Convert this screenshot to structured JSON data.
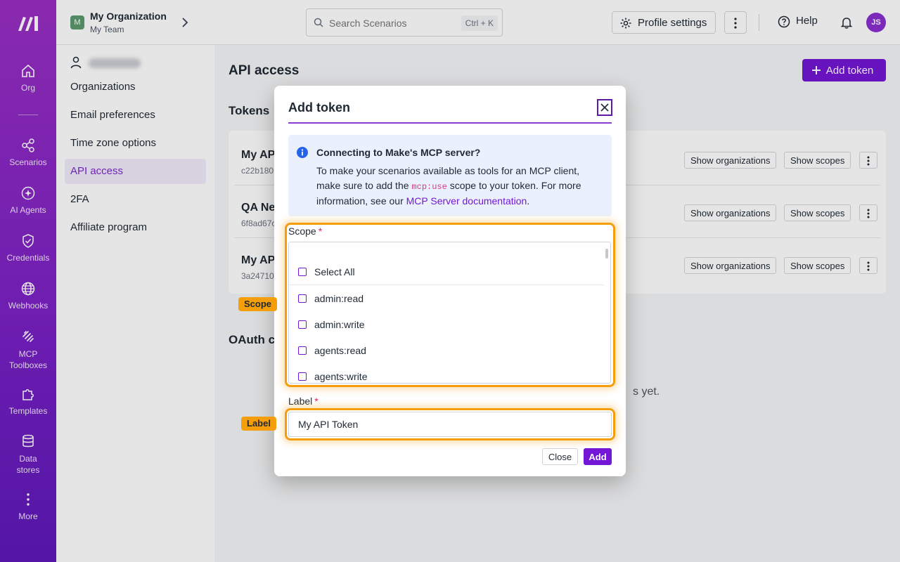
{
  "rail": {
    "items": [
      {
        "label": "Org"
      },
      {
        "label": "Scenarios"
      },
      {
        "label": "AI Agents"
      },
      {
        "label": "Credentials"
      },
      {
        "label": "Webhooks"
      },
      {
        "label": "MCP Toolboxes"
      },
      {
        "label": "Templates"
      },
      {
        "label": "Data stores"
      },
      {
        "label": "More"
      }
    ]
  },
  "topbar": {
    "org_initial": "M",
    "org_name": "My Organization",
    "team_name": "My Team",
    "search_placeholder": "Search Scenarios",
    "search_shortcut": "Ctrl + K",
    "profile_settings": "Profile settings",
    "help": "Help",
    "avatar_initials": "JS"
  },
  "settings_nav": {
    "items": [
      {
        "label": "Organizations"
      },
      {
        "label": "Email preferences"
      },
      {
        "label": "Time zone options"
      },
      {
        "label": "API access",
        "active": true
      },
      {
        "label": "2FA"
      },
      {
        "label": "Affiliate program"
      }
    ]
  },
  "main": {
    "title": "API access",
    "add_token_button": "Add token",
    "tokens_heading": "Tokens",
    "tokens": [
      {
        "name": "My AP",
        "id": "c22b180"
      },
      {
        "name": "QA Ne",
        "id": "6f8ad67c"
      },
      {
        "name": "My AP",
        "id": "3a24710"
      }
    ],
    "show_organizations": "Show organizations",
    "show_scopes": "Show scopes",
    "oauth_heading": "OAuth co",
    "empty_text": "s yet."
  },
  "modal": {
    "title": "Add token",
    "info_title": "Connecting to Make's MCP server?",
    "info_text_1": "To make your scenarios available as tools for an MCP client, make sure to add the ",
    "info_code": "mcp:use",
    "info_text_2": " scope to your token. For more information, see our ",
    "info_link": "MCP Server documentation",
    "info_text_3": ".",
    "scope_label": "Scope",
    "required_mark": "*",
    "scopes": [
      {
        "label": "Select All"
      },
      {
        "label": "admin:read"
      },
      {
        "label": "admin:write"
      },
      {
        "label": "agents:read"
      },
      {
        "label": "agents:write"
      }
    ],
    "label_label": "Label",
    "label_value": "My API Token",
    "close_button": "Close",
    "add_button": "Add"
  },
  "annotations": {
    "scope_tag": "Scope",
    "label_tag": "Label"
  },
  "colors": {
    "brand": "#7316d6",
    "highlight": "#f59e0b"
  }
}
